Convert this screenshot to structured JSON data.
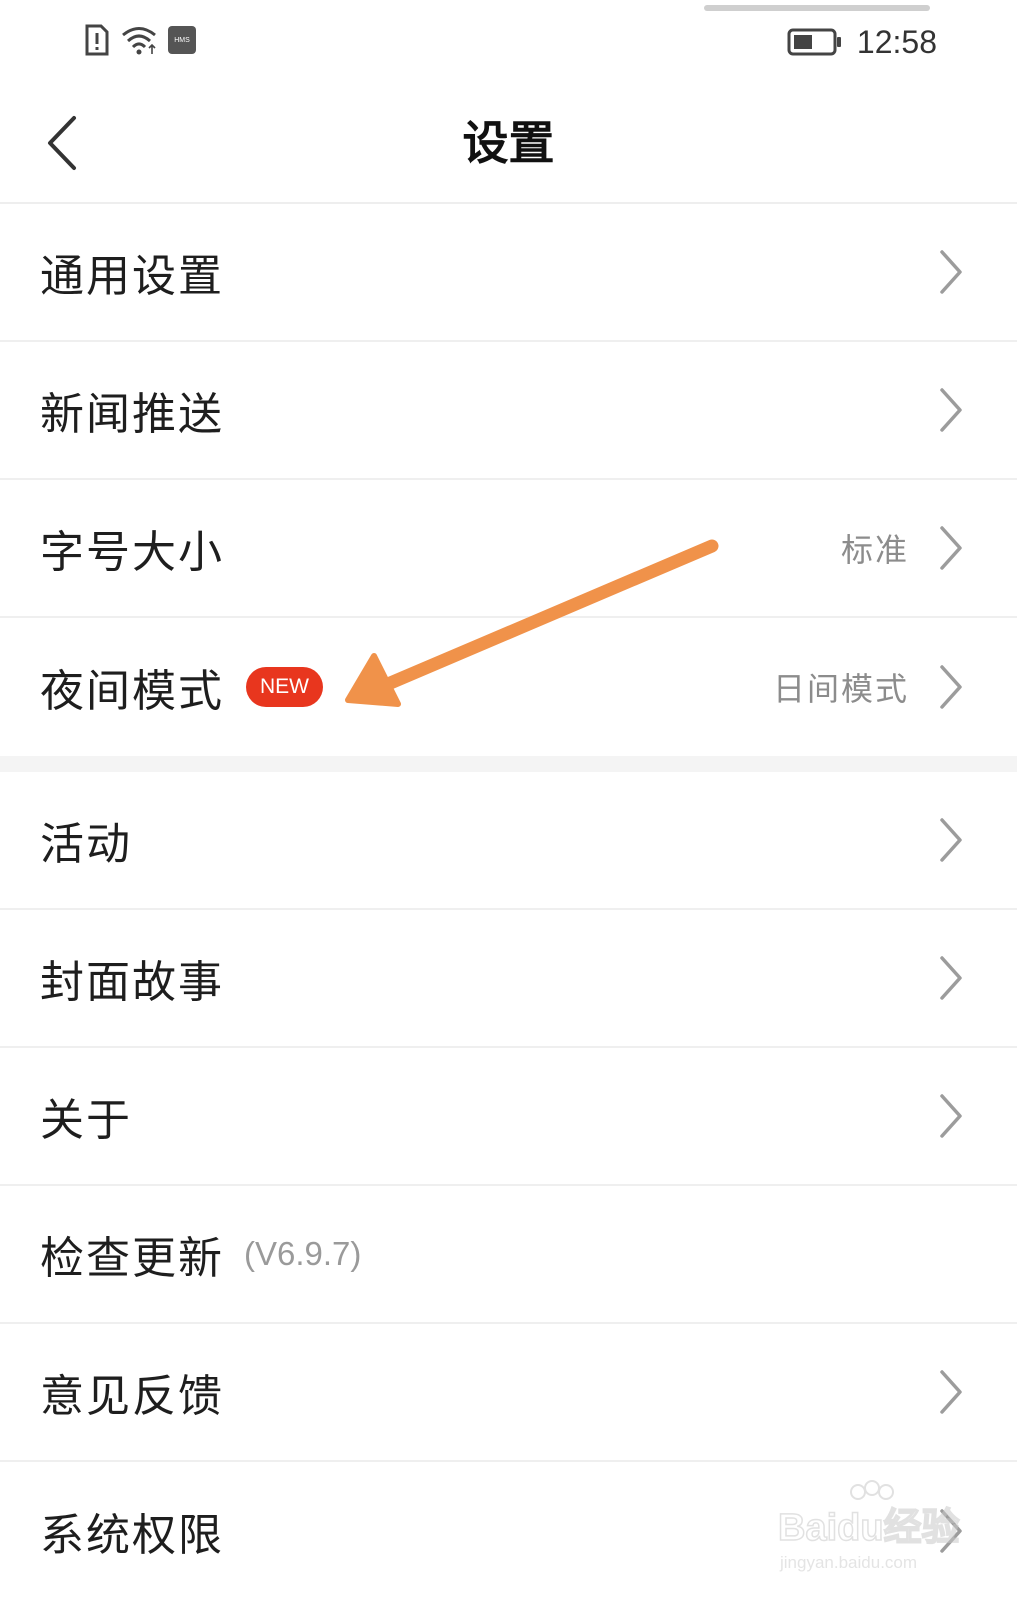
{
  "status_bar": {
    "time": "12:58",
    "hms_label": "HMS"
  },
  "header": {
    "title": "设置"
  },
  "settings": [
    {
      "label": "通用设置",
      "value": "",
      "chevron": true
    },
    {
      "label": "新闻推送",
      "value": "",
      "chevron": true
    },
    {
      "label": "字号大小",
      "value": "标准",
      "chevron": true
    },
    {
      "label": "夜间模式",
      "badge": "NEW",
      "value": "日间模式",
      "chevron": true
    },
    {
      "label": "活动",
      "value": "",
      "chevron": true
    },
    {
      "label": "封面故事",
      "value": "",
      "chevron": true
    },
    {
      "label": "关于",
      "value": "",
      "chevron": true
    },
    {
      "label": "检查更新",
      "version": "(V6.9.7)",
      "value": "",
      "chevron": false
    },
    {
      "label": "意见反馈",
      "value": "",
      "chevron": true
    },
    {
      "label": "系统权限",
      "value": "",
      "chevron": true
    }
  ],
  "annotation": {
    "arrow_color": "#f0924a"
  },
  "watermark": {
    "brand": "Baidu经验",
    "url": "jingyan.baidu.com"
  }
}
